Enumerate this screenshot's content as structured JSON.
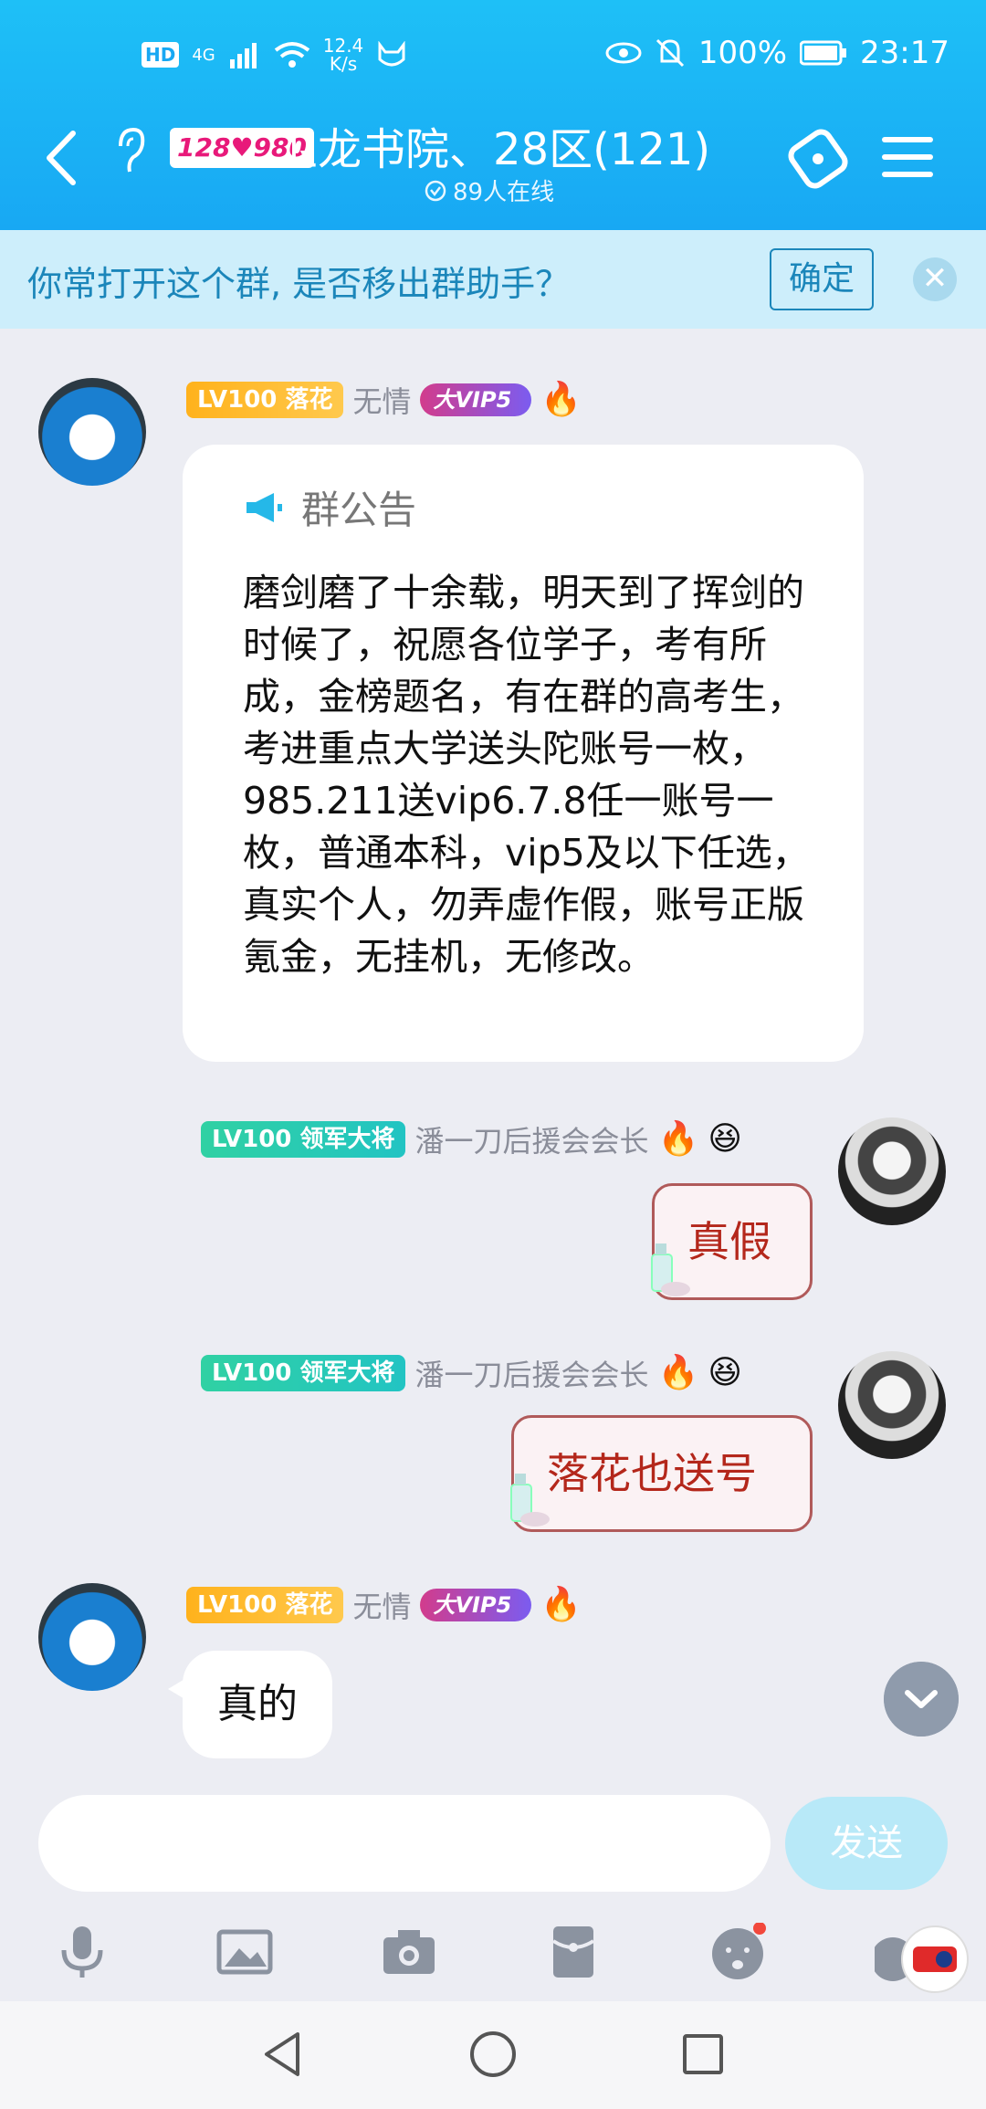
{
  "status_bar": {
    "hd": "HD",
    "network": "4G",
    "speed_value": "12.4",
    "speed_unit": "K/s",
    "battery": "100%",
    "time": "23:17"
  },
  "header": {
    "level_badge": "128♥980",
    "title": "卫龙书院、28区(121)",
    "online": "89人在线"
  },
  "notice_bar": {
    "text": "你常打开这个群, 是否移出群助手？",
    "confirm_label": "确定",
    "close_symbol": "✕"
  },
  "messages": [
    {
      "side": "left",
      "level": "LV100",
      "rank": "落花",
      "name": "无情",
      "vip": "大VIP5",
      "announcement_title": "群公告",
      "announcement_body": "磨剑磨了十余载，明天到了挥剑的时候了，祝愿各位学子，考有所成，金榜题名，有在群的高考生，考进重点大学送头陀账号一枚，985.211送vip6.7.8任一账号一枚，普通本科，vip5及以下任选，真实个人，勿弄虚作假，账号正版氪金，无挂机，无修改。"
    },
    {
      "side": "right",
      "level": "LV100",
      "rank": "领军大将",
      "name": "潘一刀后援会会长",
      "text": "真假"
    },
    {
      "side": "right",
      "level": "LV100",
      "rank": "领军大将",
      "name": "潘一刀后援会会长",
      "text": "落花也送号"
    },
    {
      "side": "left",
      "level": "LV100",
      "rank": "落花",
      "name": "无情",
      "vip": "大VIP5",
      "text": "真的"
    }
  ],
  "input": {
    "value": "",
    "send_label": "发送"
  },
  "toolbar_icons": [
    "microphone-icon",
    "image-icon",
    "camera-icon",
    "red-packet-icon",
    "emoji-icon",
    "more-icon"
  ],
  "colors": {
    "header": "#18a8f3",
    "notice_bg": "#cdeefb",
    "notice_text": "#1b86ba",
    "bg": "#ecedf3",
    "send_bg": "#b8e9f8"
  }
}
